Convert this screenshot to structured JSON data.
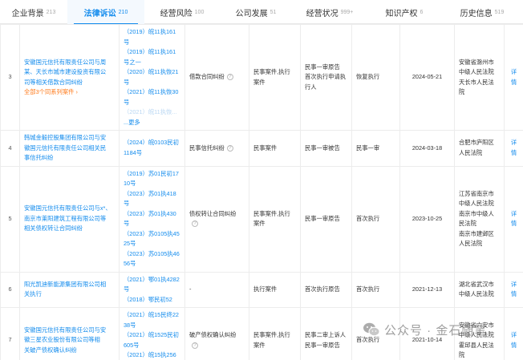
{
  "tabs": [
    {
      "label": "企业背景",
      "count": "213"
    },
    {
      "label": "法律诉讼",
      "count": "210"
    },
    {
      "label": "经营风险",
      "count": "100"
    },
    {
      "label": "公司发展",
      "count": "51"
    },
    {
      "label": "经营状况",
      "count": "999+"
    },
    {
      "label": "知识产权",
      "count": "6"
    },
    {
      "label": "历史信息",
      "count": "519"
    }
  ],
  "rows": [
    {
      "num": "3",
      "party_lines": [
        "安徽国元信托有限责任公司与周",
        "某、天长市城市建设投资有限公",
        "司等相关借款合同纠纷"
      ],
      "party_extra": "全部3个同系列案件 ›",
      "case_lines": [
        "（2019）皖11执161",
        "号",
        "（2019）皖11执161",
        "号之一",
        "（2020）皖11执恢21",
        "号",
        "（2021）皖11执恢30",
        "号"
      ],
      "case_faded": "（2021）皖11执恢...",
      "case_more": "...更多",
      "cause": "借款合同纠纷",
      "case_type": [
        "民事案件,执行",
        "案件"
      ],
      "role": [
        "民事一审原告",
        "首次执行申请执",
        "行人"
      ],
      "stage": "恢复执行",
      "date": "2024-05-21",
      "court": [
        "安徽省滁州市",
        "中级人民法院",
        "天长市人民法",
        "院"
      ],
      "detail": "详情"
    },
    {
      "num": "4",
      "party_lines": [
        "韩城金毅控股集团有限公司与安",
        "徽国元信托有限责任公司相关民",
        "事信托纠纷"
      ],
      "case_lines": [
        "（2024）皖0103民初",
        "1184号"
      ],
      "cause": "民事信托纠纷",
      "case_type": [
        "民事案件"
      ],
      "role": [
        "民事一审被告"
      ],
      "stage": "民事一审",
      "date": "2024-03-18",
      "court": [
        "合肥市庐阳区",
        "人民法院"
      ],
      "detail": "详情"
    },
    {
      "num": "5",
      "party_lines": [
        "安徽国元信托有限责任公司与x*、",
        "南京市莱阳建筑工程有限公司等",
        "相关债权转让合同纠纷"
      ],
      "case_lines": [
        "（2019）苏01民初17",
        "10号",
        "（2023）苏01执418",
        "号",
        "（2023）苏01执430",
        "号",
        "（2023）苏0105执45",
        "25号",
        "（2023）苏0105执46",
        "56号"
      ],
      "cause": "债权转让合同纠纷",
      "case_type": [
        "民事案件,执行",
        "案件"
      ],
      "role": [
        "民事一审原告"
      ],
      "stage": "首次执行",
      "date": "2023-10-25",
      "court": [
        "江苏省南京市",
        "中级人民法院",
        "南京市中级人",
        "民法院",
        "南京市建邺区",
        "人民法院"
      ],
      "detail": "详情"
    },
    {
      "num": "6",
      "party_lines": [
        "阳光凯迪新能源集团有限公司相",
        "关执行"
      ],
      "case_lines": [
        "（2021）鄂01执4282",
        "号",
        "（2018）鄂民初52"
      ],
      "cause": "-",
      "case_type": [
        "执行案件"
      ],
      "role": [
        "首次执行原告"
      ],
      "stage": "首次执行",
      "date": "2021-12-13",
      "court": [
        "湖北省武汉市",
        "中级人民法院"
      ],
      "detail": "详情"
    },
    {
      "num": "7",
      "party_lines": [
        "安徽国元信托有限责任公司与安",
        "徽三星农业股份有限公司等相",
        "关破产债权确认纠纷"
      ],
      "case_lines": [
        "（2021）皖15民终22",
        "38号",
        "（2021）皖1525民初",
        "605号",
        "（2021）皖15执256",
        "号"
      ],
      "cause": "破产债权确认纠纷",
      "case_type": [
        "民事案件,执行",
        "案件"
      ],
      "role": [
        "民事二审上诉人",
        "民事一审原告"
      ],
      "stage": "首次执行",
      "date": "2021-10-14",
      "court": [
        "安徽省六安市",
        "中级人民法院",
        "霍邱县人民法",
        "院"
      ],
      "detail": "详情"
    }
  ],
  "watermark": {
    "icon": "wechat-icon",
    "text": "公众号 · 金石随笔"
  },
  "colors": {
    "accent": "#128bed",
    "orange_link": "#ff7a1a",
    "border": "#ececec"
  }
}
